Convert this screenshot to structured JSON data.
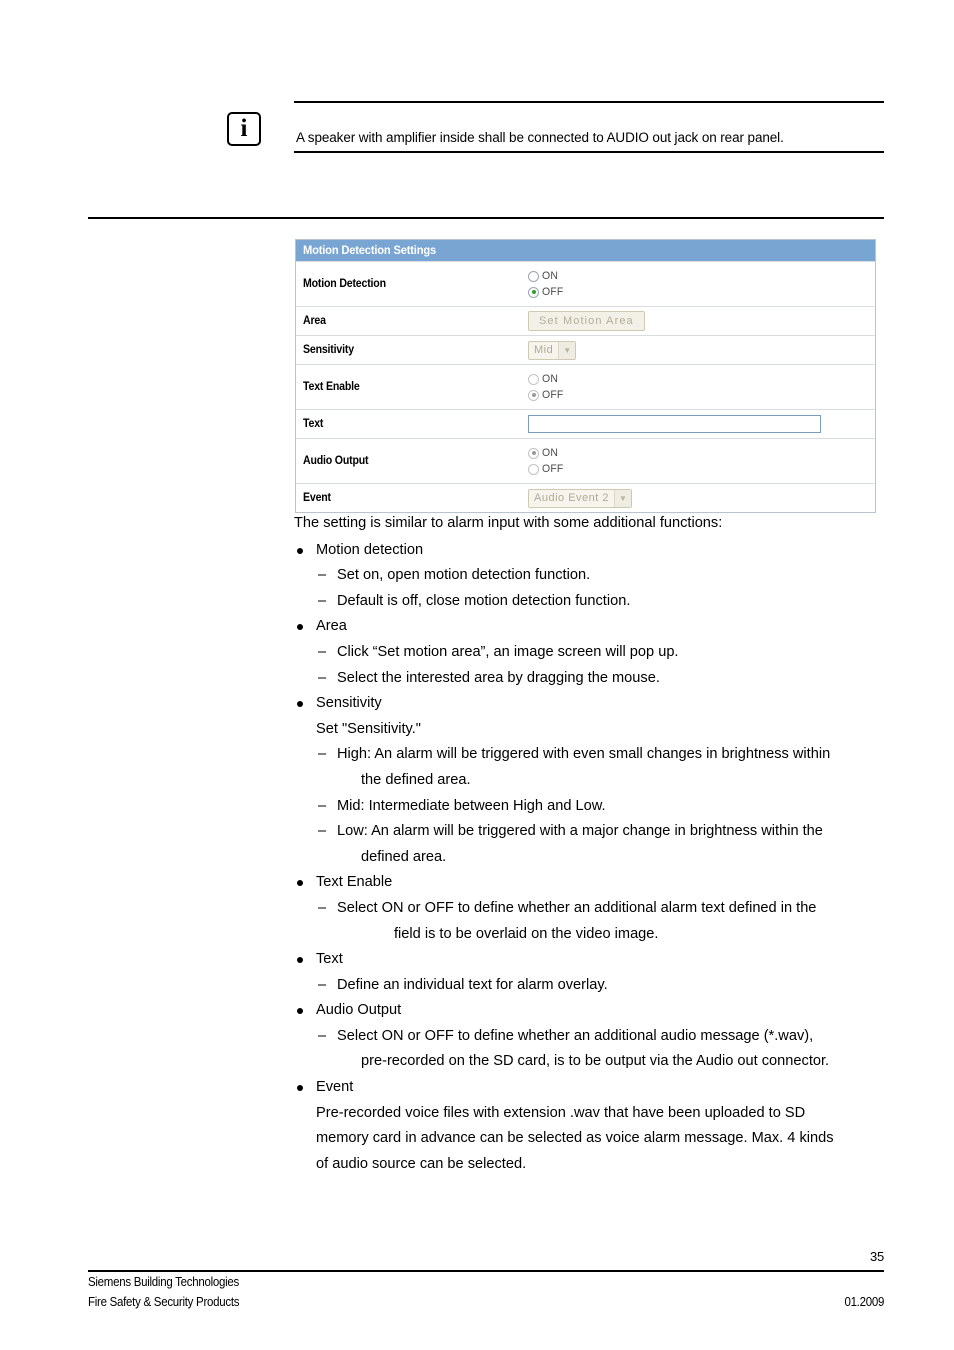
{
  "note": {
    "icon": "info-icon",
    "glyph": "i",
    "text": "A speaker with amplifier inside shall be connected to AUDIO out jack on rear panel."
  },
  "panel": {
    "title": "Motion Detection Settings",
    "header_color": "#79a5d3",
    "rows": {
      "motion_detection": {
        "label": "Motion Detection",
        "options": [
          {
            "label": "ON",
            "selected": false,
            "disabled": false
          },
          {
            "label": "OFF",
            "selected": true,
            "disabled": false
          }
        ]
      },
      "area": {
        "label": "Area",
        "button_label": "Set Motion Area",
        "disabled": true
      },
      "sensitivity": {
        "label": "Sensitivity",
        "value": "Mid",
        "disabled": true
      },
      "text_enable": {
        "label": "Text Enable",
        "options": [
          {
            "label": "ON",
            "selected": false,
            "disabled": true
          },
          {
            "label": "OFF",
            "selected": true,
            "disabled": true
          }
        ]
      },
      "text": {
        "label": "Text",
        "value": "",
        "placeholder": ""
      },
      "audio_output": {
        "label": "Audio Output",
        "options": [
          {
            "label": "ON",
            "selected": true,
            "disabled": true
          },
          {
            "label": "OFF",
            "selected": false,
            "disabled": true
          }
        ]
      },
      "event": {
        "label": "Event",
        "value": "Audio Event 2",
        "disabled": true
      }
    }
  },
  "prose": {
    "intro": "The setting is similar to alarm input with some additional functions:",
    "sections": {
      "motion_detection": {
        "title": "Motion detection",
        "item1": "Set on, open motion detection function.",
        "item2": "Default is off, close motion detection function."
      },
      "area": {
        "title": "Area",
        "item1": "Click “Set motion area”, an image screen will pop up.",
        "item2": "Select the interested area by dragging the mouse."
      },
      "sensitivity": {
        "title": "Sensitivity",
        "subtitle": "Set \"Sensitivity.\"",
        "item1_a": "High: An alarm will be triggered with even small changes in brightness within",
        "item1_b": "the defined area.",
        "item2": "Mid: Intermediate between High and Low.",
        "item3_a": "Low: An alarm will be triggered with a major change in brightness within the",
        "item3_b": "defined area."
      },
      "text_enable": {
        "title": "Text Enable",
        "item1_a": "Select ON or OFF to define whether an additional alarm text defined in the",
        "item1_b": "field is to be overlaid on the video image."
      },
      "text": {
        "title": "Text",
        "item1": "Define an individual text for alarm overlay."
      },
      "audio_output": {
        "title": "Audio Output",
        "item1_a": "Select ON or OFF to define whether an additional audio message (*.wav),",
        "item1_b": "pre-recorded on the SD card, is to be output via the Audio out connector."
      },
      "event": {
        "title": "Event",
        "body_a": "Pre-recorded voice files with extension .wav that have been uploaded to SD",
        "body_b": "memory card in advance can be selected as voice alarm message. Max. 4 kinds",
        "body_c": "of audio source can be selected."
      }
    }
  },
  "footer": {
    "page_number": "35",
    "company": "Siemens Building Technologies",
    "division": "Fire Safety & Security Products",
    "date": "01.2009"
  }
}
